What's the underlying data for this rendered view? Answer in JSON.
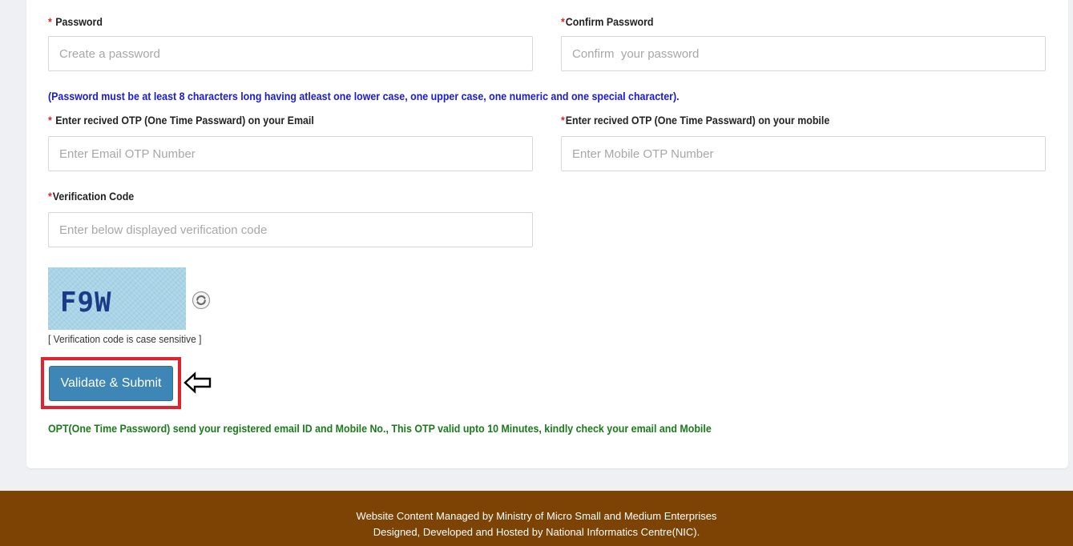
{
  "form": {
    "password": {
      "label": "Password",
      "required_mark": "*",
      "placeholder": "Create a password",
      "value": ""
    },
    "confirm_password": {
      "label": "Confirm Password",
      "required_mark": "*",
      "placeholder": "Confirm  your password",
      "value": ""
    },
    "password_hint": "(Password must be at least 8 characters long having atleast one lower case, one upper case, one numeric and one special character).",
    "email_otp": {
      "label": "Enter recived OTP (One Time Passward) on your Email",
      "required_mark": "*",
      "placeholder": "Enter Email OTP Number",
      "value": ""
    },
    "mobile_otp": {
      "label": "Enter recived OTP (One Time Passward) on your mobile",
      "required_mark": "*",
      "placeholder": "Enter Mobile OTP Number",
      "value": ""
    },
    "verification": {
      "label": "Verification Code",
      "required_mark": "*",
      "placeholder": "Enter below displayed verification code",
      "value": ""
    },
    "captcha": {
      "text": "F9W",
      "note": "[ Verification code is case sensitive ]",
      "refresh_icon": "refresh-icon"
    },
    "submit_label": "Validate & Submit",
    "otp_note": "OPT(One Time Password) send your registered email ID and Mobile No., This OTP valid upto 10 Minutes, kindly check your email and Mobile"
  },
  "annotation": {
    "highlight_color": "#e0242f",
    "arrow_icon": "left-arrow-icon"
  },
  "footer": {
    "line1": "Website Content Managed by Ministry of Micro Small and Medium Enterprises",
    "line2": "Designed, Developed and Hosted by National Informatics Centre(NIC)."
  },
  "colors": {
    "footer_bg": "#7c4305",
    "button_bg": "#3d86b6",
    "hint_blue": "#1a1ad6",
    "note_green": "#1b7a1b",
    "required_red": "#e02424"
  }
}
